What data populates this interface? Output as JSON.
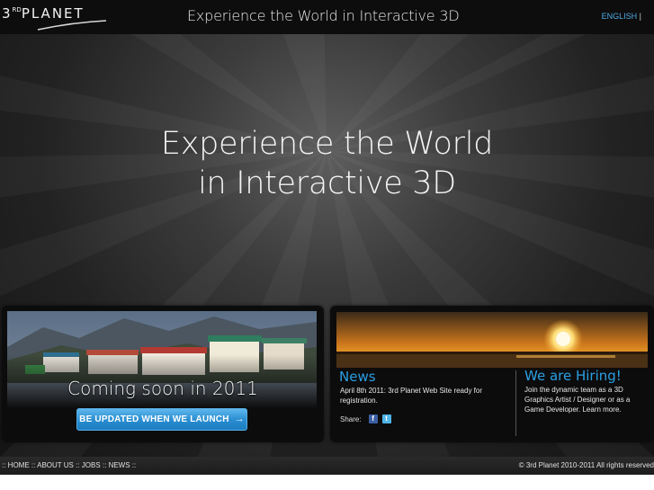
{
  "header": {
    "logo_text": "3RD PLANET",
    "logo_main": "PLANET",
    "logo_digit": "3",
    "logo_sup": "RD",
    "tagline": "Experience the World in Interactive 3D",
    "language": "ENGLISH",
    "language_separator": "|"
  },
  "hero": {
    "headline_line1": "Experience the World",
    "headline_line2": "in Interactive 3D"
  },
  "left_panel": {
    "coming_soon": "Coming soon in 2011",
    "button_label": "BE UPDATED WHEN WE LAUNCH",
    "button_arrow": "→"
  },
  "news": {
    "title": "News",
    "text": "April 8th 2011: 3rd Planet Web Site ready for registration.",
    "share_label": "Share:",
    "facebook_glyph": "f",
    "twitter_glyph": "t"
  },
  "hiring": {
    "title": "We are Hiring!",
    "text": "Join the dynamic team as a 3D Graphics Artist / Designer or as a Game Developer. Learn more."
  },
  "footer": {
    "nav": [
      {
        "sep": ":: ",
        "label": "HOME"
      },
      {
        "sep": " :: ",
        "label": "ABOUT US"
      },
      {
        "sep": " :: ",
        "label": "JOBS"
      },
      {
        "sep": " :: ",
        "label": "NEWS"
      }
    ],
    "nav_end": " ::",
    "copyright": "© 3rd Planet 2010-2011 All rights reserved"
  },
  "colors": {
    "accent_blue": "#2b9fe3",
    "button_blue": "#2a8fd2",
    "background": "#111111"
  }
}
